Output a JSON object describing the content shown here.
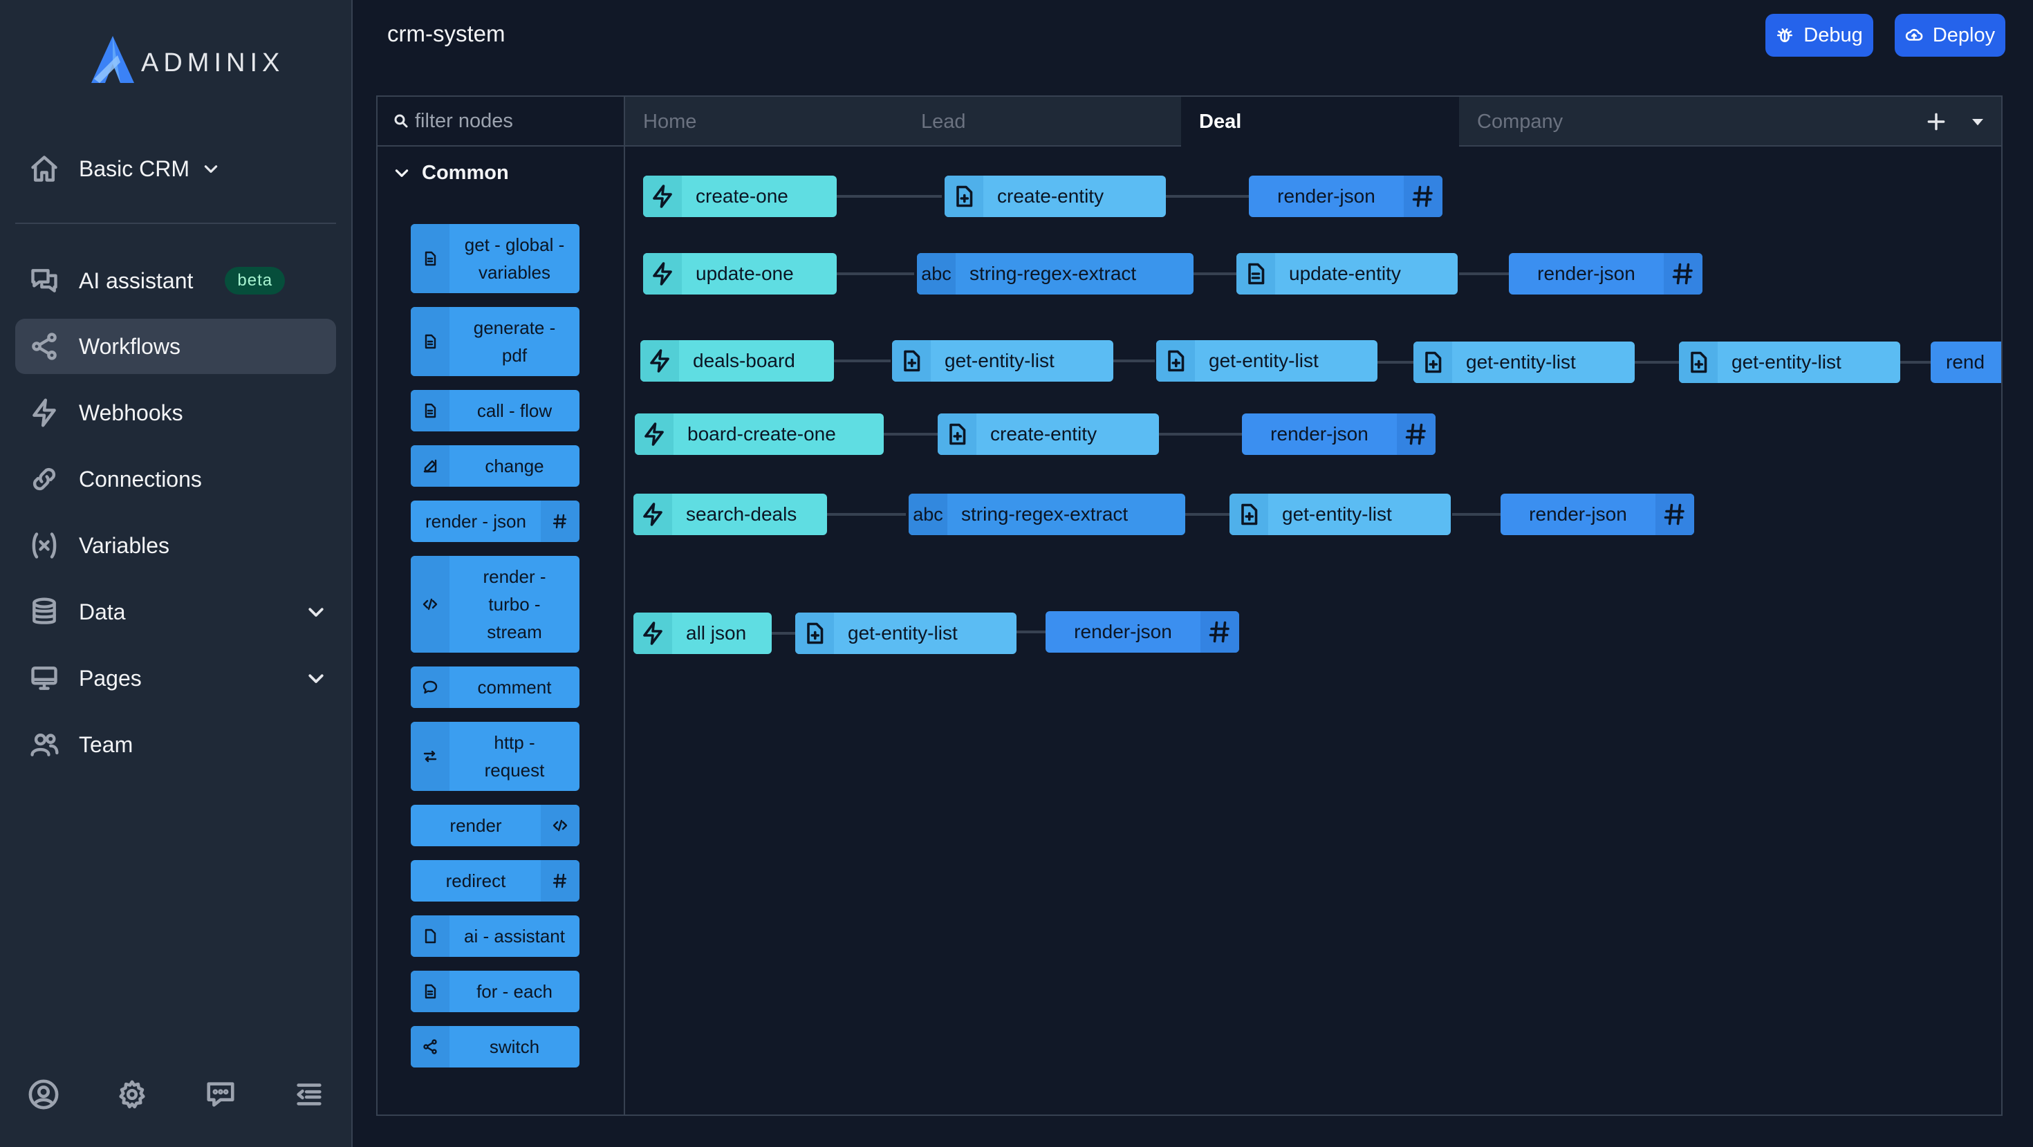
{
  "app": {
    "title": "crm-system",
    "logo_text": "ADMINIX"
  },
  "header": {
    "debug_label": "Debug",
    "deploy_label": "Deploy"
  },
  "sidebar": {
    "project": "Basic CRM",
    "items": [
      {
        "label": "AI assistant",
        "icon": "chat-bubbles-icon",
        "badge": "beta"
      },
      {
        "label": "Workflows",
        "icon": "share-icon",
        "active": true
      },
      {
        "label": "Webhooks",
        "icon": "bolt-icon"
      },
      {
        "label": "Connections",
        "icon": "link-icon"
      },
      {
        "label": "Variables",
        "icon": "variable-icon"
      },
      {
        "label": "Data",
        "icon": "database-icon",
        "expandable": true
      },
      {
        "label": "Pages",
        "icon": "monitor-icon",
        "expandable": true
      },
      {
        "label": "Team",
        "icon": "users-icon"
      }
    ],
    "footer_icons": [
      "user-circle-icon",
      "gear-icon",
      "chat-icon",
      "collapse-menu-icon"
    ]
  },
  "palette": {
    "filter_placeholder": "filter nodes",
    "group": "Common",
    "items": [
      {
        "l1": "get - global -",
        "l2": "variables",
        "icon": "document-icon"
      },
      {
        "l1": "generate -",
        "l2": "pdf",
        "icon": "document-icon"
      },
      {
        "l1": "call - flow",
        "icon": "document-icon"
      },
      {
        "l1": "change",
        "icon": "pencil-icon"
      },
      {
        "l1": "render - json",
        "icon": "hash-icon"
      },
      {
        "l1": "render -",
        "l2": "turbo -",
        "l3": "stream",
        "icon": "code-icon"
      },
      {
        "l1": "comment",
        "icon": "speech-bubble-icon"
      },
      {
        "l1": "http -",
        "l2": "request",
        "icon": "arrows-icon"
      },
      {
        "l1": "render",
        "icon": "code-icon"
      },
      {
        "l1": "redirect",
        "icon": "hash-icon"
      },
      {
        "l1": "ai - assistant",
        "icon": "document-icon"
      },
      {
        "l1": "for - each",
        "icon": "document-icon"
      },
      {
        "l1": "switch",
        "icon": "share-icon"
      }
    ]
  },
  "tabs": [
    {
      "label": "Home"
    },
    {
      "label": "Lead"
    },
    {
      "label": "Deal",
      "active": true
    },
    {
      "label": "Company"
    }
  ],
  "flows": [
    [
      "create-one",
      "create-entity",
      "render-json"
    ],
    [
      "update-one",
      "string-regex-extract",
      "update-entity",
      "render-json"
    ],
    [
      "deals-board",
      "get-entity-list",
      "get-entity-list",
      "get-entity-list",
      "get-entity-list",
      "rend"
    ],
    [
      "board-create-one",
      "create-entity",
      "render-json"
    ],
    [
      "search-deals",
      "string-regex-extract",
      "get-entity-list",
      "render-json"
    ],
    [
      "all json",
      "get-entity-list",
      "render-json"
    ]
  ],
  "abc_label": "abc",
  "colors": {
    "sidebar_bg": "#1f2937",
    "canvas_bg": "#111827",
    "accent": "#2563eb",
    "trigger_node": "#5fdde2",
    "entity_node": "#5bbcf3",
    "json_node": "#3b8ff0",
    "palette_node": "#3b9ef0"
  }
}
